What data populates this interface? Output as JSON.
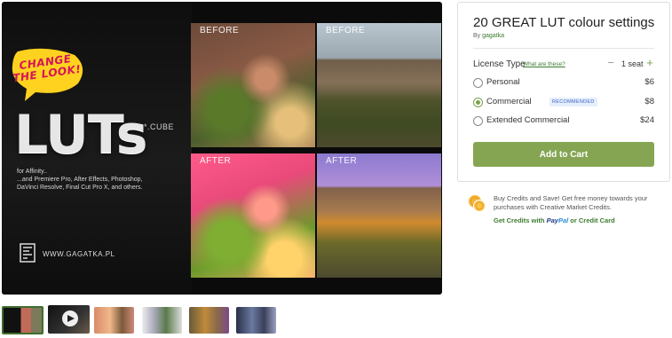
{
  "preview": {
    "bubble_line1": "CHANGE",
    "bubble_line2": "THE LOOK!",
    "luts_word": "LUTs",
    "cube_tag": "*.CUBE",
    "for_line": "for Affinity..",
    "compat_line1": "...and Premiere Pro, After Effects, Photoshop,",
    "compat_line2": "DaVinci Resolve, Final Cut Pro X, and others.",
    "site_url": "WWW.GAGATKA.PL",
    "label_before_1": "BEFORE",
    "label_before_2": "BEFORE",
    "label_after_1": "AFTER",
    "label_after_2": "AFTER"
  },
  "thumbnails": [
    {
      "name": "thumb-1",
      "selected": true
    },
    {
      "name": "thumb-2-video",
      "has_play_icon": true
    },
    {
      "name": "thumb-3"
    },
    {
      "name": "thumb-4"
    },
    {
      "name": "thumb-5"
    },
    {
      "name": "thumb-6"
    }
  ],
  "product": {
    "title": "20 GREAT LUT colour settings",
    "by_prefix": "By ",
    "author": "gagatka",
    "license_label": "License Type",
    "what_link": "What are these?",
    "quantity_text": "1 seat",
    "options": [
      {
        "label": "Personal",
        "price": "$6",
        "selected": false
      },
      {
        "label": "Commercial",
        "price": "$8",
        "selected": true,
        "badge": "RECOMMENDED"
      },
      {
        "label": "Extended Commercial",
        "price": "$24",
        "selected": false
      }
    ],
    "add_to_cart": "Add to Cart"
  },
  "credits": {
    "text": "Buy Credits and Save! Get free money towards your purchases with Creative Market Credits.",
    "link_prefix": "Get Credits with ",
    "paypal_a": "Pay",
    "paypal_b": "Pal",
    "link_suffix": " or Credit Card"
  },
  "colors": {
    "accent_green": "#85a553",
    "link_green": "#3d7a2e",
    "badge_blue": "#3a66c4",
    "bubble_yellow": "#ffd21f",
    "bubble_text": "#d4145a"
  }
}
